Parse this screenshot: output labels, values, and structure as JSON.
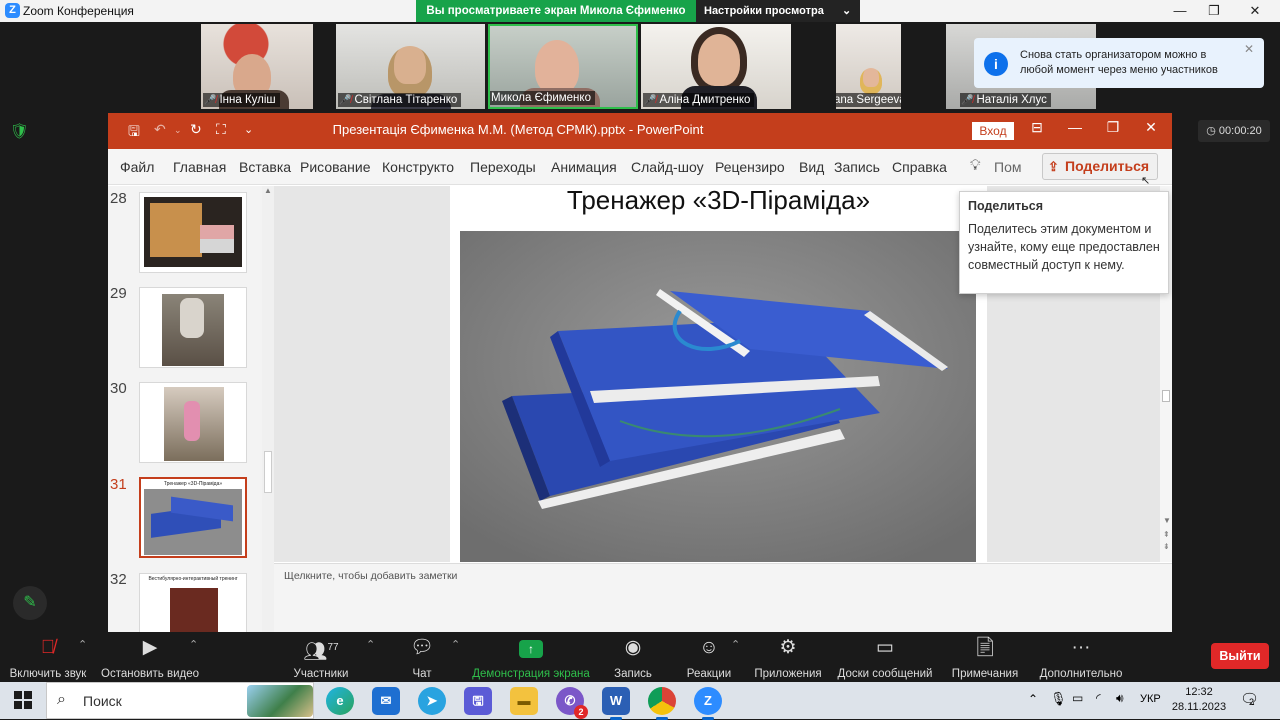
{
  "zoom_window": {
    "title": "Zoom Конференция",
    "minimize": "—",
    "maximize": "❐",
    "close": "✕"
  },
  "share_banner": {
    "viewing_text": "Вы просматриваете экран Микола Єфименко",
    "view_settings": "Настройки просмотра"
  },
  "participants": [
    {
      "name": "Інна Куліш"
    },
    {
      "name": "Світлана Тітаренко"
    },
    {
      "name": "Микола Єфименко"
    },
    {
      "name": "Аліна Дмитренко"
    },
    {
      "name": "Svetlana Sergeeva"
    },
    {
      "name": "Наталія Хлус"
    }
  ],
  "notification": {
    "text": "Снова стать организатором можно в любой момент через меню участников"
  },
  "timer": "00:00:20",
  "powerpoint": {
    "title": "Презентація Єфименка М.М. (Метод СРМК).pptx  -  PowerPoint",
    "sign_in": "Вход",
    "ribbon_tabs": [
      "Файл",
      "Главная",
      "Вставка",
      "Рисование",
      "Конструкто",
      "Переходы",
      "Анимация",
      "Слайд-шоу",
      "Рецензиро",
      "Вид",
      "Запись",
      "Справка"
    ],
    "tell_me": "Пом",
    "share_button": "Поделиться",
    "tooltip_title": "Поделиться",
    "tooltip_body": "Поделитесь этим документом и узнайте, кому еще предоставлен совместный доступ к нему.",
    "thumbnails": [
      {
        "num": "28"
      },
      {
        "num": "29"
      },
      {
        "num": "30"
      },
      {
        "num": "31",
        "caption": "Тренажер «3D-Піраміда»"
      },
      {
        "num": "32",
        "caption": "Вестибулярно-интерактивный тренинг"
      }
    ],
    "slide_title": "Тренажер «3D-Піраміда»",
    "notes_placeholder": "Щелкните, чтобы добавить заметки"
  },
  "zoom_toolbar": {
    "mute": "Включить звук",
    "video": "Остановить видео",
    "participants": "Участники",
    "participants_count": "77",
    "chat": "Чат",
    "share_screen": "Демонстрация экрана",
    "record": "Запись",
    "reactions": "Реакции",
    "apps": "Приложения",
    "whiteboards": "Доски сообщений",
    "notes": "Примечания",
    "more": "Дополнительно",
    "leave": "Выйти"
  },
  "taskbar": {
    "search_placeholder": "Поиск",
    "language": "УКР",
    "time": "12:32",
    "date": "28.11.2023",
    "notifications_count": "2",
    "viber_badge": "2"
  },
  "colors": {
    "ppt_accent": "#c43e1c",
    "zoom_green": "#17a34a",
    "zoom_blue": "#2d8cff",
    "leave_red": "#e02828"
  }
}
